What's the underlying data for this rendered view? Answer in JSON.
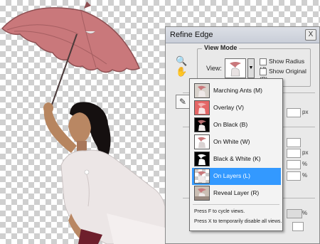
{
  "dialog": {
    "title": "Refine Edge",
    "close_label": "X"
  },
  "tools": {
    "zoom_icon": "zoom-icon",
    "hand_icon": "hand-icon",
    "brush_icon": "refine-brush-icon"
  },
  "view_mode": {
    "legend": "View Mode",
    "view_label": "View:",
    "show_radius": "Show Radius (J)",
    "show_original": "Show Original (P)"
  },
  "units": {
    "px1": "px",
    "px2": "px",
    "pct1": "%",
    "pct2": "%",
    "pct3": "%"
  },
  "dropdown": {
    "items": [
      {
        "label": "Marching Ants (M)",
        "selected": false
      },
      {
        "label": "Overlay (V)",
        "selected": false
      },
      {
        "label": "On Black (B)",
        "selected": false
      },
      {
        "label": "On White (W)",
        "selected": false
      },
      {
        "label": "Black & White (K)",
        "selected": false
      },
      {
        "label": "On Layers (L)",
        "selected": true
      },
      {
        "label": "Reveal Layer (R)",
        "selected": false
      }
    ],
    "hint1": "Press F to cycle views.",
    "hint2": "Press X to temporarily disable all views."
  },
  "colors": {
    "selection": "#3399ff",
    "umbrella": "#c9787b",
    "overlay_red": "#e46666"
  }
}
